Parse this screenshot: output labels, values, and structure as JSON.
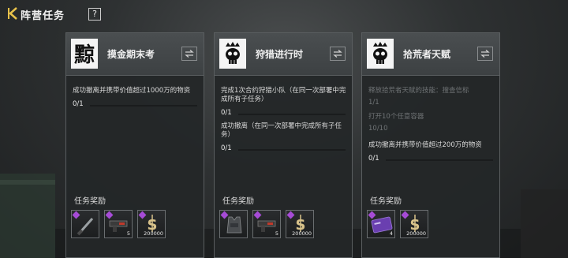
{
  "header": {
    "title": "阵营任务",
    "help_label": "?"
  },
  "cards": [
    {
      "name": "摸金期末考",
      "emblem_char": "黥",
      "tasks": [
        {
          "text": "成功撤离并携带价值超过1000万的物资",
          "progress": "0/1",
          "fraction": 0,
          "done": false
        }
      ],
      "reward_label": "任务奖励",
      "rewards": [
        {
          "icon": "knife-icon",
          "qty": ""
        },
        {
          "icon": "gun-icon",
          "qty": "5"
        },
        {
          "icon": "currency-icon",
          "qty": "200000"
        }
      ]
    },
    {
      "name": "狩猎进行时",
      "emblem_char": "",
      "tasks": [
        {
          "text": "完成1次合约狩猎小队（在同一次部署中完成所有子任务）",
          "progress": "0/1",
          "fraction": 0,
          "done": false
        },
        {
          "text": "成功撤离（在同一次部署中完成所有子任务）",
          "progress": "0/1",
          "fraction": 0,
          "done": false
        }
      ],
      "reward_label": "任务奖励",
      "rewards": [
        {
          "icon": "vest-icon",
          "qty": ""
        },
        {
          "icon": "gun-icon",
          "qty": "5"
        },
        {
          "icon": "currency-icon",
          "qty": "200000"
        }
      ]
    },
    {
      "name": "拾荒者天赋",
      "emblem_char": "",
      "tasks": [
        {
          "text": "释放拾荒者天赋的技能：搜查信标",
          "progress": "1/1",
          "fraction": 1,
          "done": true
        },
        {
          "text": "打开10个任意容器",
          "progress": "10/10",
          "fraction": 1,
          "done": true
        },
        {
          "text": "成功撤离并携带价值超过200万的物资",
          "progress": "0/1",
          "fraction": 0,
          "done": false
        }
      ],
      "reward_label": "任务奖励",
      "rewards": [
        {
          "icon": "card-icon",
          "qty": "4"
        },
        {
          "icon": "currency-icon",
          "qty": "200000"
        }
      ]
    }
  ],
  "colors": {
    "rarity": "#a64bd6",
    "panel": "#242728",
    "gold": "#d8c28a"
  }
}
